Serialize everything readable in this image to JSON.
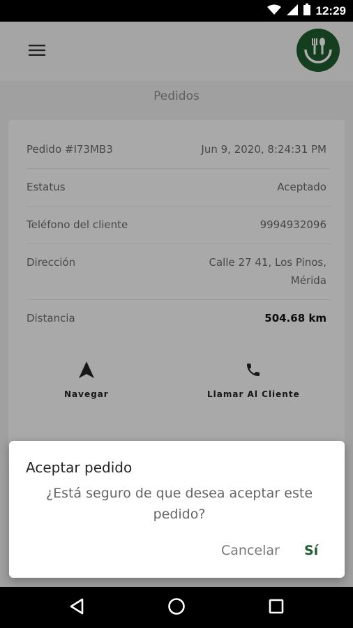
{
  "status_bar": {
    "time": "12:29"
  },
  "header": {
    "logo_alt": "fork-spoon-logo"
  },
  "page_title": "Pedidos",
  "order": {
    "rows": [
      {
        "label": "Pedido #I73MB3",
        "value": "Jun 9, 2020, 8:24:31 PM"
      },
      {
        "label": "Estatus",
        "value": "Aceptado"
      },
      {
        "label": "Teléfono del cliente",
        "value": "9994932096"
      },
      {
        "label": "Dirección",
        "value_line1": "Calle 27 41, Los Pinos,",
        "value_line2": "Mérida"
      },
      {
        "label": "Distancia",
        "value": "504.68 km"
      }
    ],
    "actions": {
      "navigate": "Navegar",
      "call": "Llamar Al Cliente"
    }
  },
  "dialog": {
    "title": "Aceptar pedido",
    "message": "¿Está seguro de que desea aceptar este pedido?",
    "cancel": "Cancelar",
    "confirm": "Sí"
  },
  "colors": {
    "brand": "#1f5c2e",
    "scrim": "rgba(0,0,0,0.32)"
  }
}
